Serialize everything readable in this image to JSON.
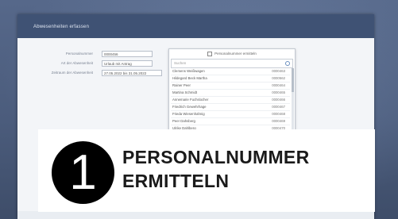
{
  "window": {
    "title": "Abwesenheiten erfassen"
  },
  "form": {
    "rows": [
      {
        "label": "Personalnummer",
        "value": "0000456"
      },
      {
        "label": "Art der Abwesenheit",
        "value": "Urlaub mit Antrag"
      },
      {
        "label": "Zeitraum der Abwesenheit",
        "value": "27.05.2022 bis 31.05.2022"
      }
    ]
  },
  "popup": {
    "header": "Personalnummer ermitteln",
    "search_placeholder": "Suchen",
    "items": [
      {
        "name": "Clemens Weißwagen",
        "number": "0000463"
      },
      {
        "name": "Hildegard Beck Martha",
        "number": "0000562"
      },
      {
        "name": "Rainer Peer",
        "number": "0000464"
      },
      {
        "name": "Martina Schmidt",
        "number": "0000465"
      },
      {
        "name": "Annemarie Fuchslocher",
        "number": "0000466"
      },
      {
        "name": "Friedrich Gewehrhage",
        "number": "0000467"
      },
      {
        "name": "Frieda Wiesenhahnig",
        "number": "0000468"
      },
      {
        "name": "Peer Dahsberg",
        "number": "0000469"
      },
      {
        "name": "Ulrike Dahlberg",
        "number": "0000470"
      }
    ]
  },
  "overlay": {
    "step_number": "1",
    "title_line1": "PERSONALNUMMER",
    "title_line2": "ERMITTELN"
  }
}
